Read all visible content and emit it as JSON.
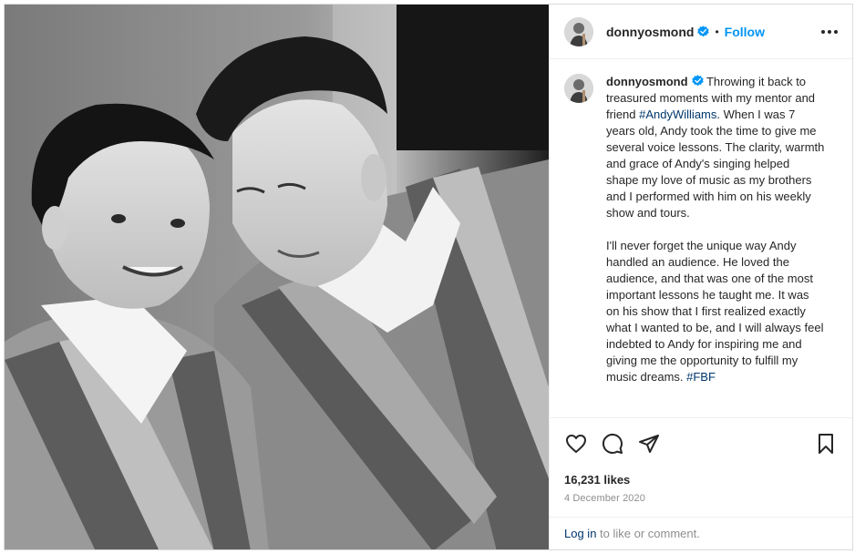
{
  "post": {
    "photo": {
      "description_icon": "photo"
    },
    "header": {
      "username": "donnyosmond",
      "separator": "•",
      "follow_label": "Follow"
    },
    "caption": {
      "username": "donnyosmond",
      "paragraph1_a": "Throwing it back to treasured moments with my mentor and friend ",
      "hashtag1": "#AndyWilliams",
      "paragraph1_b": ". When I was 7 years old, Andy took the time to give me several voice lessons. The clarity, warmth and grace of Andy's singing helped shape my love of music as my brothers and I performed with him on his weekly show and tours.",
      "paragraph2": "I'll never forget the unique way Andy handled an audience. He loved the audience, and that was one of the most important lessons he taught me. It was on his show that I first realized exactly what I wanted to be, and I will always feel indebted to Andy for inspiring me and giving me the opportunity to fulfill my music dreams. ",
      "hashtag2": "#FBF"
    },
    "actions": {
      "icons": [
        "heart-icon",
        "comment-icon",
        "share-icon",
        "bookmark-icon"
      ],
      "likes": "16,231 likes",
      "date": "4 December 2020"
    },
    "login": {
      "link": "Log in",
      "rest": " to like or comment."
    },
    "colors": {
      "accent": "#0095f6",
      "link": "#00376b",
      "verified": "#0095f6",
      "muted": "#8e8e8e"
    }
  }
}
